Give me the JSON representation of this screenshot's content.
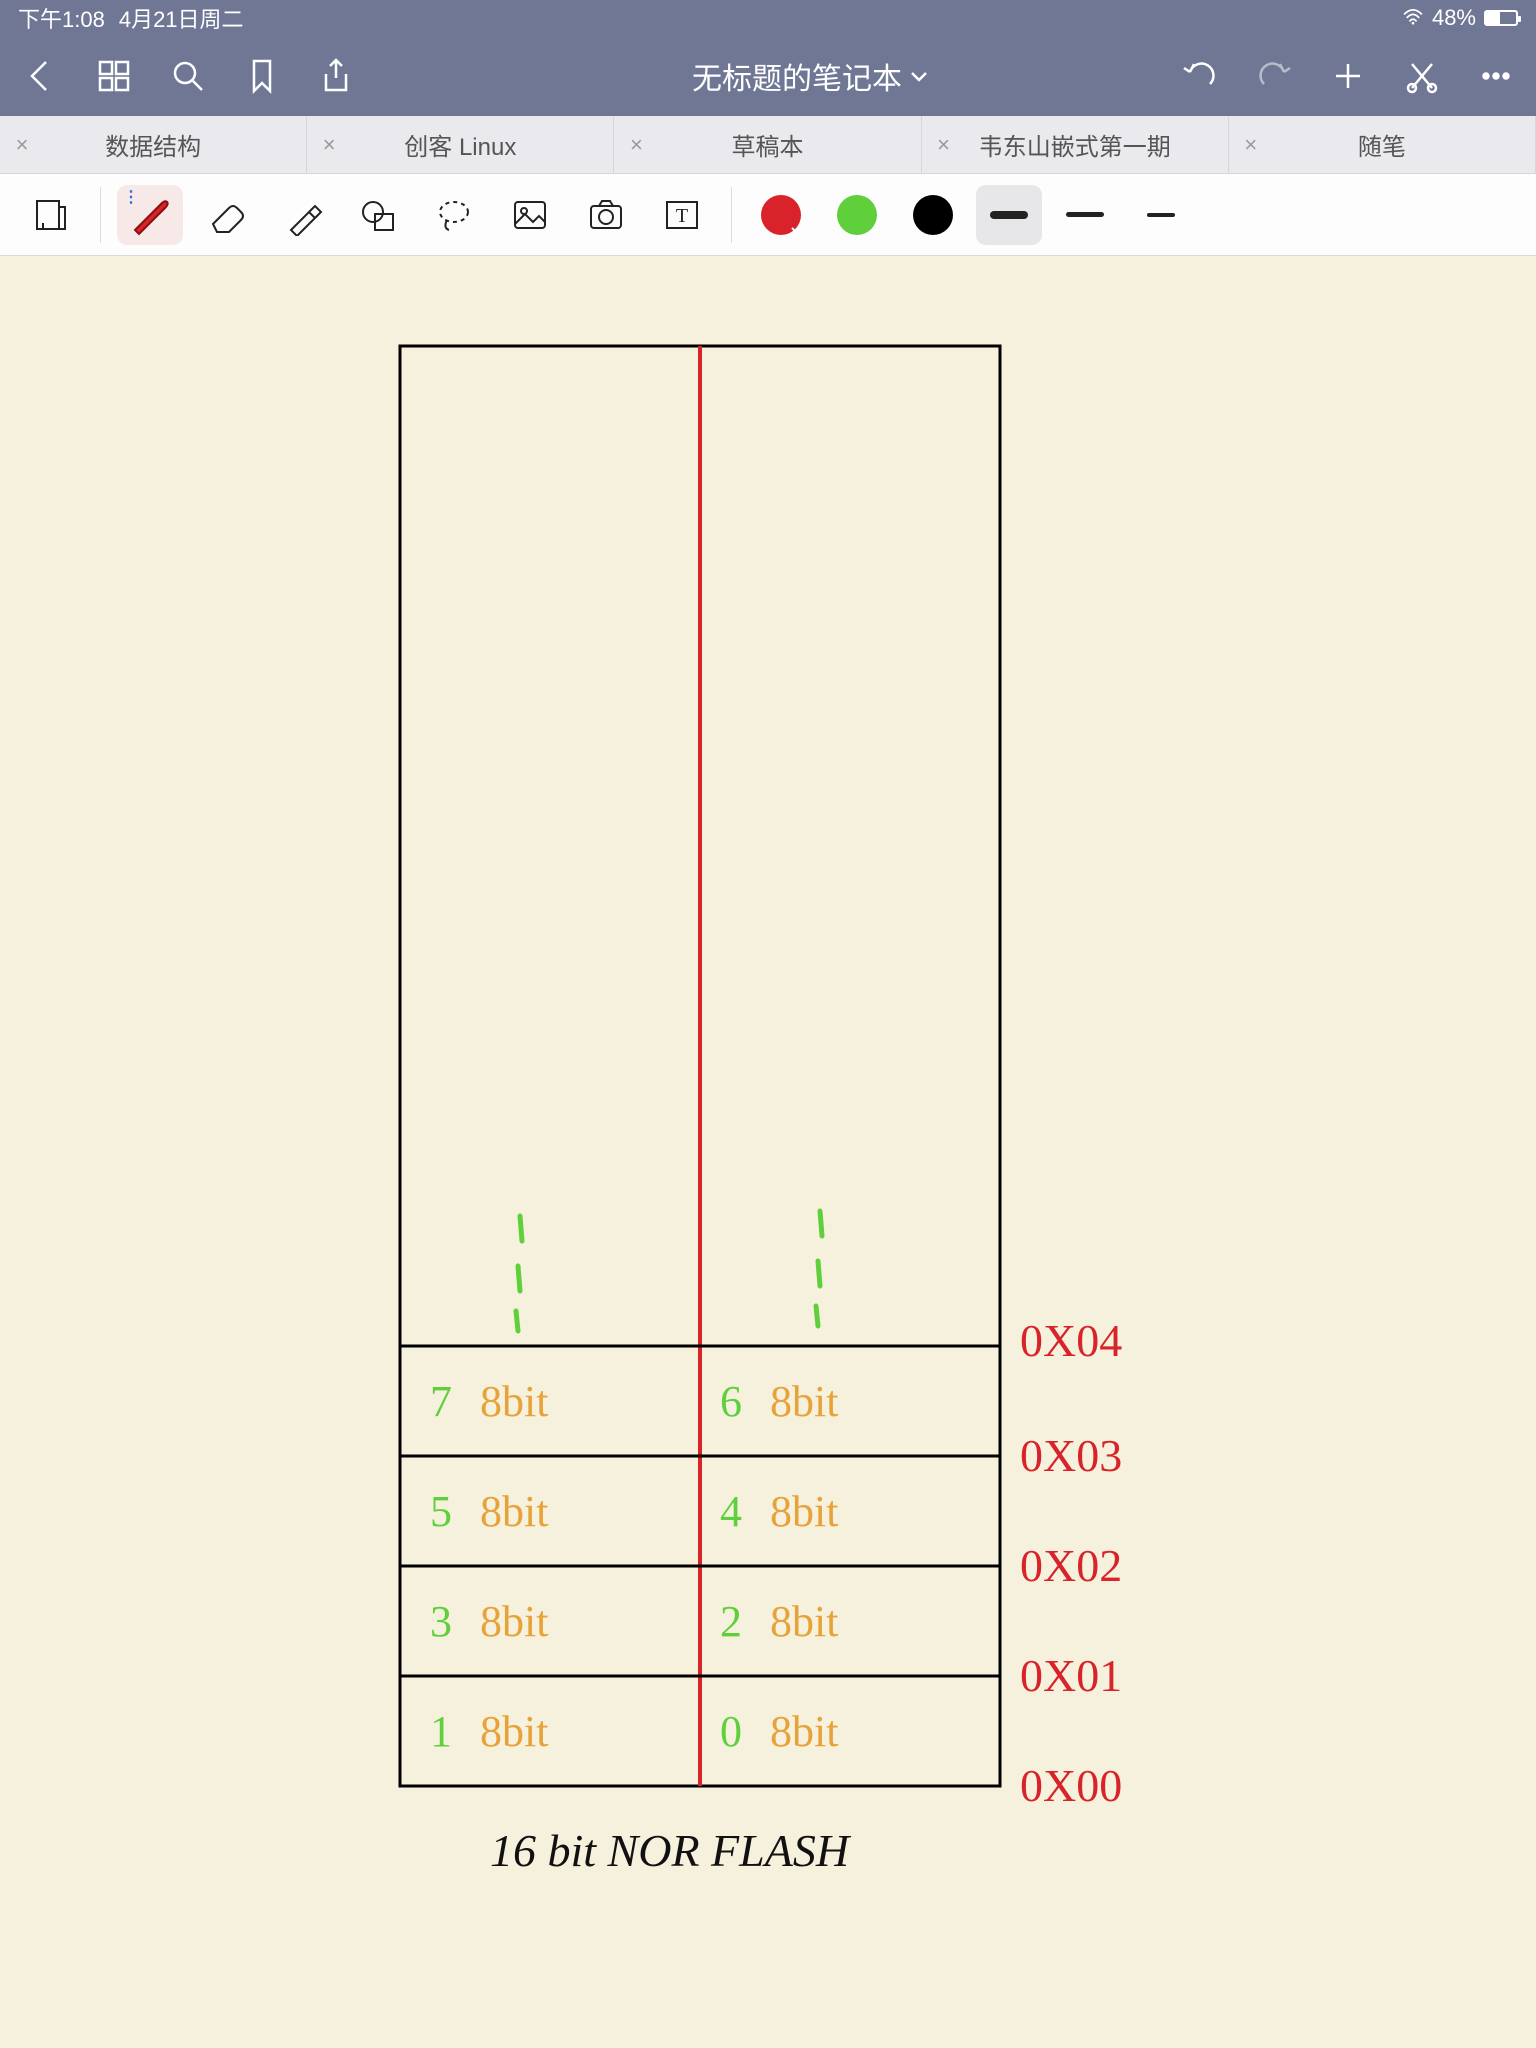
{
  "status": {
    "time": "下午1:08",
    "date": "4月21日周二",
    "battery": "48%"
  },
  "title": "无标题的笔记本",
  "tabs": [
    {
      "label": "数据结构"
    },
    {
      "label": "创客 Linux"
    },
    {
      "label": "草稿本"
    },
    {
      "label": "韦东山嵌式第一期"
    },
    {
      "label": "随笔"
    }
  ],
  "colors": {
    "red": "#d8232a",
    "green": "#5fcf3c",
    "black": "#000000"
  },
  "diagram": {
    "rows": [
      {
        "leftNum": "7",
        "leftBits": "8bit",
        "rightNum": "6",
        "rightBits": "8bit"
      },
      {
        "leftNum": "5",
        "leftBits": "8bit",
        "rightNum": "4",
        "rightBits": "8bit"
      },
      {
        "leftNum": "3",
        "leftBits": "8bit",
        "rightNum": "2",
        "rightBits": "8bit"
      },
      {
        "leftNum": "1",
        "leftBits": "8bit",
        "rightNum": "0",
        "rightBits": "8bit"
      }
    ],
    "addresses": [
      "0X04",
      "0X03",
      "0X02",
      "0X01",
      "0X00"
    ],
    "caption": "16 bit NOR FLASH"
  }
}
